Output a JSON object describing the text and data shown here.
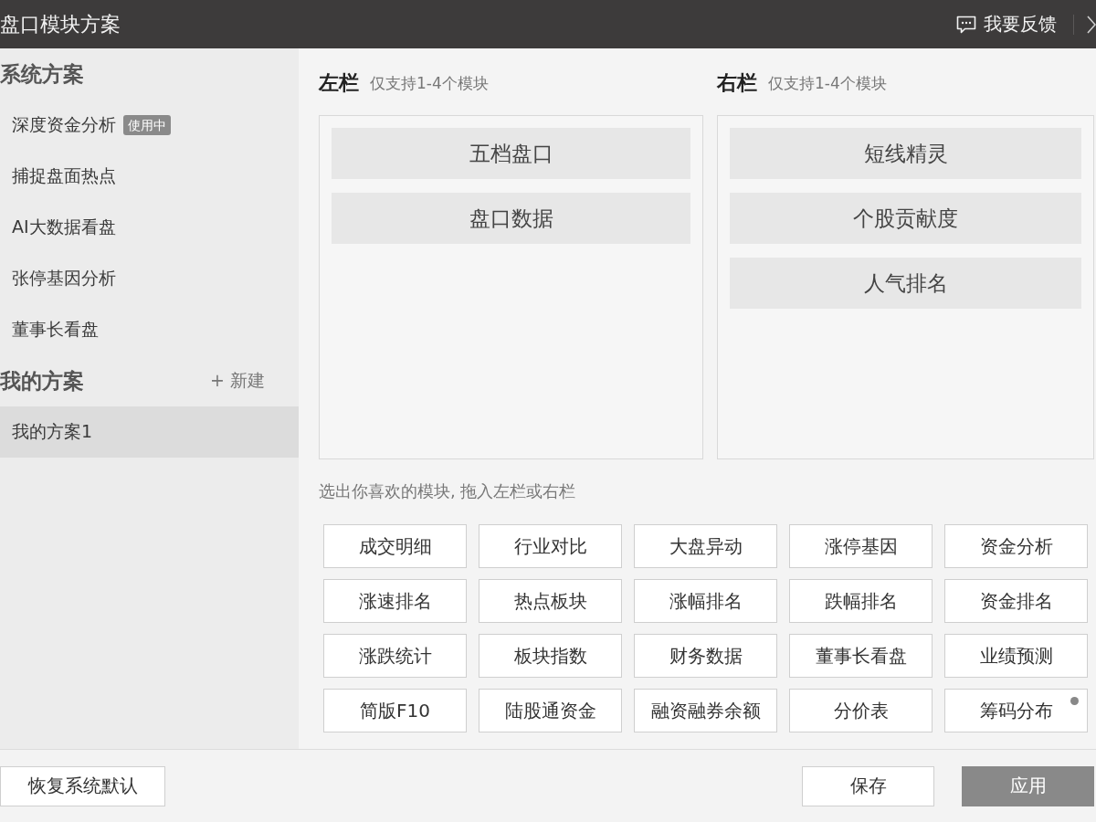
{
  "window": {
    "title": "盘口模块方案",
    "feedback": "我要反馈"
  },
  "sidebar": {
    "sections": [
      {
        "title": "系统方案",
        "items": [
          {
            "label": "深度资金分析",
            "badge": "使用中",
            "selected": false
          },
          {
            "label": "捕捉盘面热点",
            "selected": false
          },
          {
            "label": "AI大数据看盘",
            "selected": false
          },
          {
            "label": "张停基因分析",
            "selected": false
          },
          {
            "label": "董事长看盘",
            "selected": false
          }
        ]
      },
      {
        "title": "我的方案",
        "action": "+ 新建",
        "items": [
          {
            "label": "我的方案1",
            "selected": true
          }
        ]
      }
    ]
  },
  "columns": [
    {
      "title": "左栏",
      "note": "仅支持1-4个模块",
      "modules": [
        "五档盘口",
        "盘口数据"
      ]
    },
    {
      "title": "右栏",
      "note": "仅支持1-4个模块",
      "modules": [
        "短线精灵",
        "个股贡献度",
        "人气排名"
      ]
    }
  ],
  "palette": {
    "hint": "选出你喜欢的模块, 拖入左栏或右栏",
    "modules": [
      {
        "label": "成交明细",
        "dot": false
      },
      {
        "label": "行业对比",
        "dot": false
      },
      {
        "label": "大盘异动",
        "dot": false
      },
      {
        "label": "涨停基因",
        "dot": false
      },
      {
        "label": "资金分析",
        "dot": false
      },
      {
        "label": "涨速排名",
        "dot": false
      },
      {
        "label": "热点板块",
        "dot": false
      },
      {
        "label": "涨幅排名",
        "dot": false
      },
      {
        "label": "跌幅排名",
        "dot": false
      },
      {
        "label": "资金排名",
        "dot": false
      },
      {
        "label": "涨跌统计",
        "dot": false
      },
      {
        "label": "板块指数",
        "dot": false
      },
      {
        "label": "财务数据",
        "dot": false
      },
      {
        "label": "董事长看盘",
        "dot": false
      },
      {
        "label": "业绩预测",
        "dot": false
      },
      {
        "label": "简版F10",
        "dot": false
      },
      {
        "label": "陆股通资金",
        "dot": false
      },
      {
        "label": "融资融券余额",
        "dot": false
      },
      {
        "label": "分价表",
        "dot": false
      },
      {
        "label": "筹码分布",
        "dot": true
      }
    ]
  },
  "footer": {
    "left": [
      {
        "label": "恢复系统默认",
        "kind": "default"
      }
    ],
    "right": [
      {
        "label": "保存",
        "kind": "default"
      },
      {
        "label": "应用",
        "kind": "primary"
      }
    ]
  }
}
